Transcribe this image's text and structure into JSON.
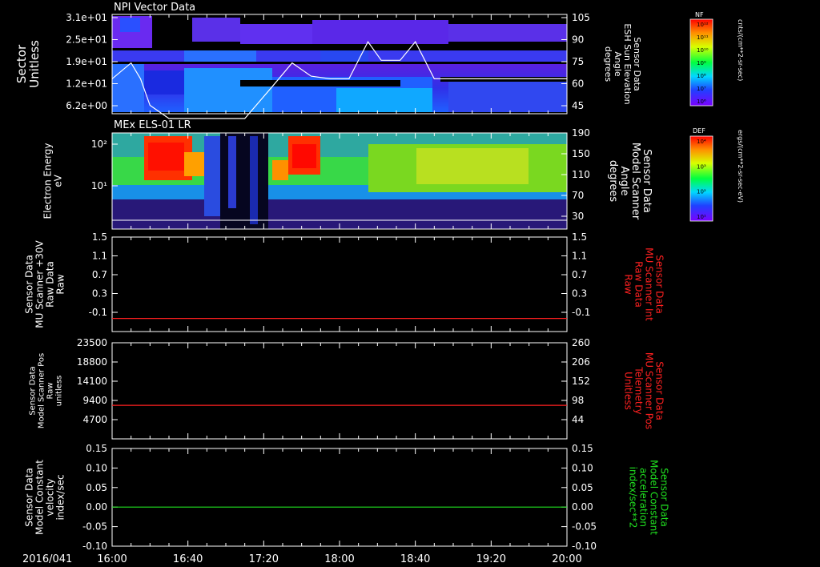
{
  "date_label": "2016/041",
  "time_ticks": [
    "16:00",
    "16:40",
    "17:20",
    "18:00",
    "18:40",
    "19:20",
    "20:00"
  ],
  "colors": {
    "background": "#000000",
    "axis": "#ffffff",
    "red_line": "#ff2020",
    "green_line": "#20e020",
    "red_label": "#ff2020",
    "green_label": "#20e020"
  },
  "chart_data": [
    {
      "type": "heatmap",
      "title": "NPI Vector Data",
      "left_label": [
        "Sector",
        "Unitless"
      ],
      "y_ticks_left": [
        "3.1e+01",
        "2.5e+01",
        "1.9e+01",
        "1.2e+01",
        "6.2e+00"
      ],
      "right_label": [
        "Sensor Data",
        "ESH Sun Elevation",
        "Angle",
        "degrees"
      ],
      "y_ticks_right": [
        "105",
        "90",
        "75",
        "60",
        "45"
      ],
      "overlay_series": {
        "name": "ESH Sun Elevation Angle",
        "x": [
          "16:00",
          "16:10",
          "16:15",
          "16:20",
          "16:30",
          "16:40",
          "16:55",
          "17:10",
          "17:25",
          "17:35",
          "17:45",
          "17:55",
          "18:05",
          "18:15",
          "18:22",
          "18:32",
          "18:40",
          "18:50",
          "19:00",
          "19:20",
          "20:00"
        ],
        "y": [
          60,
          72,
          60,
          40,
          30,
          30,
          30,
          30,
          55,
          72,
          62,
          60,
          60,
          88,
          74,
          74,
          88,
          60,
          60,
          60,
          60
        ]
      },
      "colorbar": {
        "title": "NF",
        "unit": "cnts/(cm**2-sr-sec)",
        "ticks": [
          "10¹²",
          "10¹¹",
          "10¹⁰",
          "10⁹",
          "10⁸",
          "10⁷",
          "10⁶"
        ]
      }
    },
    {
      "type": "heatmap",
      "title": "MEx ELS-01 LR",
      "left_label": [
        "Electron Energy",
        "eV"
      ],
      "y_ticks_left": [
        "10²",
        "10¹"
      ],
      "right_label": [
        "Sensor Data",
        "Model Scanner",
        "Angle",
        "degrees"
      ],
      "y_ticks_right": [
        "190",
        "150",
        "110",
        "70",
        "30"
      ],
      "colorbar": {
        "title": "DEF",
        "unit": "ergs/(cm**2-sr-sec-eV)",
        "ticks": [
          "10⁴",
          "10³",
          "10²",
          "10¹"
        ]
      }
    },
    {
      "type": "line",
      "left_label": [
        "Sensor Data",
        "MU Scanner +30V",
        "Raw Data",
        "Raw"
      ],
      "y_ticks_left": [
        "1.5",
        "1.1",
        "0.7",
        "0.3",
        "-0.1"
      ],
      "ylim_left": [
        -0.3,
        1.5
      ],
      "right_label": [
        "Sensor Data",
        "MU Scanner Int",
        "Raw Data",
        "Raw"
      ],
      "y_ticks_right": [
        "1.5",
        "1.1",
        "0.7",
        "0.3",
        "-0.1"
      ],
      "series": [
        {
          "x": [
            "16:00",
            "20:00"
          ],
          "y": [
            -0.05,
            -0.05
          ],
          "color": "#ff2020"
        }
      ]
    },
    {
      "type": "line",
      "left_label": [
        "Sensor Data",
        "Model Scanner Pos",
        "Raw",
        "unitless"
      ],
      "y_ticks_left": [
        "23500",
        "18800",
        "14100",
        "9400",
        "4700"
      ],
      "ylim_left": [
        0,
        23500
      ],
      "right_label": [
        "Sensor Data",
        "MU Scanner Pos",
        "Telemetry",
        "Unitless"
      ],
      "y_ticks_right": [
        "260",
        "206",
        "152",
        "98",
        "44"
      ],
      "series": [
        {
          "x": [
            "16:00",
            "20:00"
          ],
          "y": [
            8200,
            8200
          ],
          "color": "#ff2020"
        }
      ]
    },
    {
      "type": "line",
      "left_label": [
        "Sensor Data",
        "Model Constant",
        "velocity",
        "index/sec"
      ],
      "y_ticks_left": [
        "0.15",
        "0.10",
        "0.05",
        "0.00",
        "-0.05",
        "-0.10"
      ],
      "ylim_left": [
        -0.1,
        0.15
      ],
      "right_label": [
        "Sensor Data",
        "Model Constant",
        "acceleration",
        "index/sec**2"
      ],
      "y_ticks_right": [
        "0.15",
        "0.10",
        "0.05",
        "0.00",
        "-0.05",
        "-0.10"
      ],
      "series": [
        {
          "x": [
            "16:00",
            "20:00"
          ],
          "y": [
            0.0,
            0.0
          ],
          "color": "#20e020"
        }
      ]
    }
  ]
}
